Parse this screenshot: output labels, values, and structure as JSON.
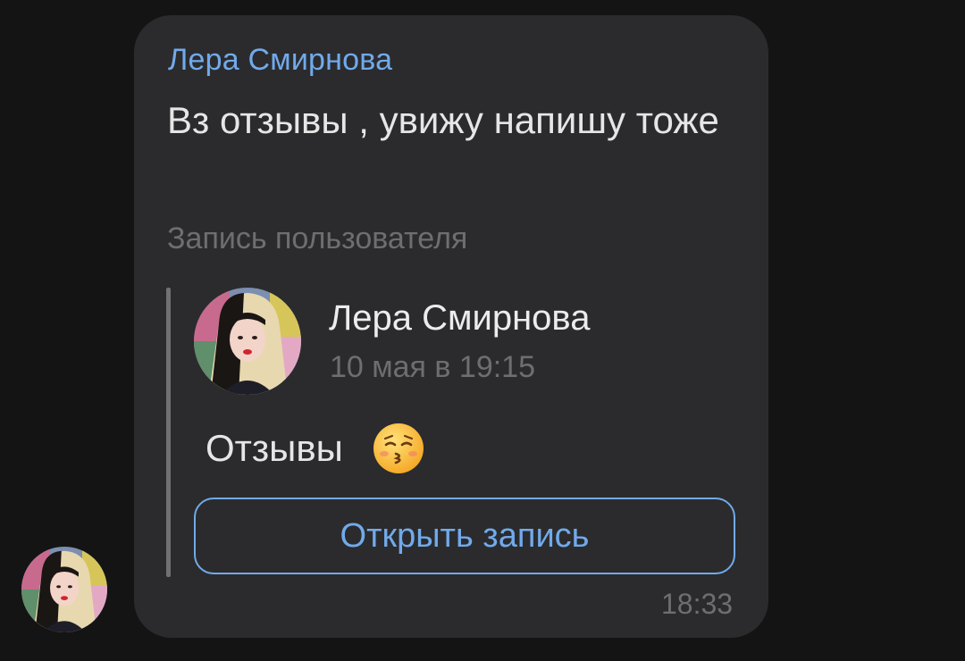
{
  "message": {
    "sender_name": "Лера Смирнова",
    "text": "Вз отзывы , увижу напишу тоже",
    "time": "18:33"
  },
  "forwarded_post": {
    "caption": "Запись пользователя",
    "author": "Лера Смирнова",
    "date": "10 мая в 19:15",
    "text": "Отзывы",
    "emoji": "kissing-face-with-closed-eyes-icon",
    "open_button_label": "Открыть запись"
  },
  "colors": {
    "accent": "#71aaeb",
    "bubble": "#2b2b2d",
    "background": "#141414",
    "muted": "#6e6e71"
  }
}
